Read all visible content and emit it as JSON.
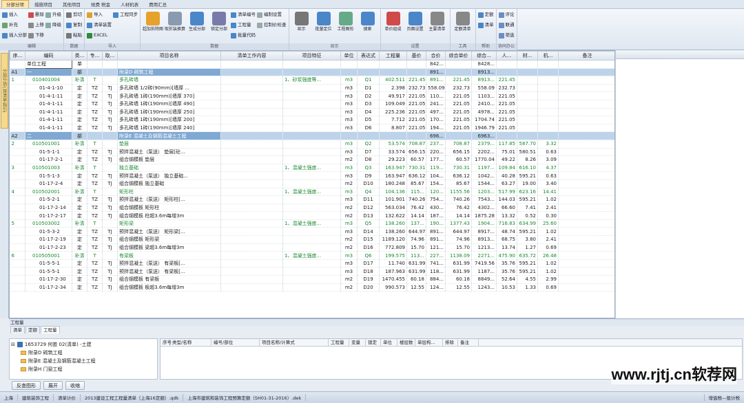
{
  "tabs": [
    "分部分项",
    "措施项目",
    "其他项目",
    "规费 税金",
    "人材机表",
    "费用汇总"
  ],
  "groups": [
    {
      "label": "编辑",
      "cols": [
        [
          {
            "t": "插入",
            "c": "#4a86c8"
          },
          {
            "t": "补充",
            "c": "#6ba36b"
          },
          {
            "t": "插入分部",
            "c": "#4a86c8"
          }
        ],
        [
          {
            "t": "删除",
            "c": "#d04a4a"
          },
          {
            "t": "上移",
            "c": "#8a8a8a"
          },
          {
            "t": "下移",
            "c": "#8a8a8a"
          }
        ],
        [
          {
            "t": "升级",
            "c": "#8aa"
          },
          {
            "t": "降级",
            "c": "#8aa"
          }
        ]
      ]
    },
    {
      "label": "数据",
      "cols": [
        [
          {
            "t": "剪切",
            "c": "#777"
          },
          {
            "t": "复制",
            "c": "#4a86c8"
          },
          {
            "t": "粘贴",
            "c": "#777"
          }
        ]
      ]
    },
    {
      "label": "导入",
      "cols": [
        [
          {
            "t": "导入",
            "c": "#e0a030"
          },
          {
            "t": "清单装置",
            "c": "#4a86c8"
          },
          {
            "t": "EXCEL",
            "c": "#2f8a3a"
          }
        ],
        [
          {
            "t": "工程同步",
            "c": "#4a86c8"
          }
        ]
      ]
    }
  ],
  "large_buttons": [
    {
      "t": "超加拆除图",
      "c": "#e6a22b"
    },
    {
      "t": "取折装换算",
      "c": "#8a9bb0"
    },
    {
      "t": "生成分部",
      "c": "#4a86c8"
    },
    {
      "t": "锁定分部",
      "c": "#7a7aaa"
    },
    {
      "t": "显示",
      "c": "#777"
    },
    {
      "t": "批量定位",
      "c": "#4a86c8"
    },
    {
      "t": "工程图形",
      "c": "#6a8"
    },
    {
      "t": "搜索",
      "c": "#4a86c8"
    },
    {
      "t": "单价组成",
      "c": "#d04a4a"
    },
    {
      "t": "页面设置",
      "c": "#4a86c8"
    },
    {
      "t": "主要清单",
      "c": "#888"
    },
    {
      "t": "定额清单",
      "c": "#888"
    }
  ],
  "data_group": {
    "label": "数据",
    "items": [
      "清单编号",
      "工程量",
      "批量代码",
      "编制设置",
      "控制价检查"
    ]
  },
  "misc_items": [
    "定额",
    "清单",
    "评论",
    "联通",
    "筛选"
  ],
  "group_labels": {
    "view": "显示",
    "settings": "设置",
    "tools": "工具",
    "help": "帮助",
    "collab": "协同办公"
  },
  "side_tab": "分部分项(按清单指引)",
  "columns": [
    "序...",
    "编码",
    "类...",
    "专...",
    "取...",
    "项目名称",
    "清单工作内容",
    "项目特征",
    "单位",
    "表达式",
    "工程量",
    "基价",
    "合价",
    "综合单价",
    "综合...",
    "人...",
    "材...",
    "机...",
    "备注"
  ],
  "rows": [
    {
      "k": "unit",
      "c": [
        "",
        "单位工程",
        "单",
        "",
        "",
        "",
        "",
        "",
        "",
        "",
        "",
        "",
        "842...",
        "",
        "8428...",
        "",
        "",
        "",
        ""
      ]
    },
    {
      "k": "sec",
      "c": [
        "A1",
        "一",
        "部",
        "",
        "",
        "附录D 砌筑工程",
        "",
        "",
        "",
        "",
        "",
        "",
        "891...",
        "",
        "8913...",
        "",
        "",
        "",
        ""
      ]
    },
    {
      "k": "item",
      "c": [
        "1",
        "010401004",
        "补清",
        "T",
        "",
        "多孔砖墙",
        "",
        "1、砂浆强度等...",
        "m3",
        "Q1",
        "402.511",
        "221.45",
        "891...",
        "221.45",
        "8913...",
        "221.45",
        "",
        "",
        ""
      ]
    },
    {
      "k": "sub",
      "c": [
        "",
        "01-4-1-10",
        "定",
        "TZ",
        "TJ",
        "多孔砖墙 1/2砖(90mm)[墙厚 ...",
        "",
        "",
        "m3",
        "D1",
        "2.398",
        "232.73",
        "558.09",
        "232.73",
        "558.09",
        "232.73",
        "",
        "",
        ""
      ]
    },
    {
      "k": "sub",
      "c": [
        "",
        "01-4-1-11",
        "定",
        "TZ",
        "TJ",
        "多孔砖墙 1砖(190mm)[墙厚 370]",
        "",
        "",
        "m3",
        "D2",
        "49.917",
        "221.05",
        "110...",
        "221.05",
        "1103...",
        "221.05",
        "",
        "",
        ""
      ]
    },
    {
      "k": "sub",
      "c": [
        "",
        "01-4-1-11",
        "定",
        "TZ",
        "TJ",
        "多孔砖墙 1砖(190mm)[墙厚 490]",
        "",
        "",
        "m3",
        "D3",
        "109.049",
        "221.05",
        "241...",
        "221.05",
        "2410...",
        "221.05",
        "",
        "",
        ""
      ]
    },
    {
      "k": "sub",
      "c": [
        "",
        "01-4-1-11",
        "定",
        "TZ",
        "TJ",
        "多孔砖墙 1砖(190mm)[墙厚 250]",
        "",
        "",
        "m3",
        "D4",
        "225.236",
        "221.05",
        "497...",
        "221.05",
        "4978...",
        "221.05",
        "",
        "",
        ""
      ]
    },
    {
      "k": "sub",
      "c": [
        "",
        "01-4-1-11",
        "定",
        "TZ",
        "TJ",
        "多孔砖墙 1砖(190mm)[墙厚 200]",
        "",
        "",
        "m3",
        "D5",
        "7.712",
        "221.05",
        "170...",
        "221.05",
        "1704.74",
        "221.05",
        "",
        "",
        ""
      ]
    },
    {
      "k": "sub",
      "c": [
        "",
        "01-4-1-11",
        "定",
        "TZ",
        "TJ",
        "多孔砖墙 1砖(190mm)[墙厚 240]",
        "",
        "",
        "m3",
        "D6",
        "8.807",
        "221.05",
        "194...",
        "221.05",
        "1946.79",
        "221.05",
        "",
        "",
        ""
      ]
    },
    {
      "k": "sec",
      "c": [
        "A2",
        "二",
        "部",
        "",
        "",
        "附录E 混凝土及钢筋混凝土工程",
        "",
        "",
        "",
        "",
        "",
        "",
        "696...",
        "",
        "6963...",
        "",
        "",
        "",
        ""
      ]
    },
    {
      "k": "item",
      "c": [
        "2",
        "010501001",
        "补清",
        "T",
        "",
        "垫层",
        "",
        "",
        "m3",
        "Q2",
        "53.574",
        "708.87",
        "237...",
        "708.87",
        "2379...",
        "117.85",
        "587.70",
        "3.32",
        ""
      ]
    },
    {
      "k": "sub",
      "c": [
        "",
        "01-5-1-1",
        "定",
        "TZ",
        "TJ",
        "预拌混凝土（泵送） 垫层[砼...",
        "",
        "",
        "m3",
        "D7",
        "33.574",
        "656.15",
        "220...",
        "656.15",
        "2202...",
        "75.01",
        "580.51",
        "0.63",
        ""
      ]
    },
    {
      "k": "sub",
      "c": [
        "",
        "01-17-2-1",
        "定",
        "TZ",
        "TJ",
        "组合钢模板 垫层",
        "",
        "",
        "m2",
        "D8",
        "29.223",
        "60.57",
        "177...",
        "60.57",
        "1770.04",
        "49.22",
        "8.26",
        "3.09",
        ""
      ]
    },
    {
      "k": "item",
      "c": [
        "3",
        "010501003",
        "补清",
        "T",
        "",
        "独立基础",
        "",
        "1、混凝土强度...",
        "m3",
        "Q3",
        "163.947",
        "730.31",
        "119...",
        "730.31",
        "1197...",
        "109.84",
        "616.10",
        "4.37",
        ""
      ]
    },
    {
      "k": "sub",
      "c": [
        "",
        "01-5-1-3",
        "定",
        "TZ",
        "TJ",
        "预拌混凝土（泵送） 独立基础...",
        "",
        "",
        "m3",
        "D9",
        "163.947",
        "636.12",
        "104...",
        "636.12",
        "1042...",
        "40.28",
        "595.21",
        "0.63",
        ""
      ]
    },
    {
      "k": "sub",
      "c": [
        "",
        "01-17-2-4",
        "定",
        "TZ",
        "TJ",
        "组合钢模板 独立基础",
        "",
        "",
        "m2",
        "D10",
        "180.248",
        "85.67",
        "154...",
        "85.67",
        "1544...",
        "63.27",
        "19.00",
        "3.40",
        ""
      ]
    },
    {
      "k": "item",
      "c": [
        "4",
        "010502001",
        "补清",
        "T",
        "",
        "矩形柱",
        "",
        "1、混凝土强度...",
        "m3",
        "Q4",
        "104.136",
        "115...",
        "120...",
        "1155.56",
        "1203...",
        "517.99",
        "623.16",
        "14.41",
        ""
      ]
    },
    {
      "k": "sub",
      "c": [
        "",
        "01-5-2-1",
        "定",
        "TZ",
        "TJ",
        "预拌混凝土（泵送） 矩形柱[...",
        "",
        "",
        "m3",
        "D11",
        "101.901",
        "740.26",
        "754...",
        "740.26",
        "7543...",
        "144.03",
        "595.21",
        "1.02",
        ""
      ]
    },
    {
      "k": "sub",
      "c": [
        "",
        "01-17-2-14",
        "定",
        "TZ",
        "TJ",
        "组合钢模板 矩形柱",
        "",
        "",
        "m2",
        "D12",
        "563.034",
        "76.42",
        "430...",
        "76.42",
        "4302...",
        "66.60",
        "7.41",
        "2.41",
        ""
      ]
    },
    {
      "k": "sub",
      "c": [
        "",
        "01-17-2-17",
        "定",
        "TZ",
        "TJ",
        "组合钢模板 柱超3.6m每增3m",
        "",
        "",
        "m2",
        "D13",
        "132.622",
        "14.14",
        "187...",
        "14.14",
        "1875.28",
        "13.32",
        "0.52",
        "0.30",
        ""
      ]
    },
    {
      "k": "item",
      "c": [
        "5",
        "010503002",
        "补清",
        "T",
        "",
        "矩形梁",
        "",
        "1、混凝土强度...",
        "m3",
        "Q5",
        "138.260",
        "137...",
        "190...",
        "1377.43",
        "1904...",
        "716.83",
        "634.99",
        "25.60",
        ""
      ]
    },
    {
      "k": "sub",
      "c": [
        "",
        "01-5-3-2",
        "定",
        "TZ",
        "TJ",
        "预拌混凝土（泵送） 矩形梁[...",
        "",
        "",
        "m3",
        "D14",
        "138.260",
        "644.97",
        "891...",
        "644.97",
        "8917...",
        "48.74",
        "595.21",
        "1.02",
        ""
      ]
    },
    {
      "k": "sub",
      "c": [
        "",
        "01-17-2-19",
        "定",
        "TZ",
        "TJ",
        "组合钢模板 矩形梁",
        "",
        "",
        "m2",
        "D15",
        "1189.120",
        "74.96",
        "891...",
        "74.96",
        "8913...",
        "68.75",
        "3.80",
        "2.41",
        ""
      ]
    },
    {
      "k": "sub",
      "c": [
        "",
        "01-17-2-23",
        "定",
        "TZ",
        "TJ",
        "组合钢模板 梁超3.6m每增3m",
        "",
        "",
        "m2",
        "D16",
        "772.809",
        "15.70",
        "121...",
        "15.70",
        "1213...",
        "13.74",
        "1.27",
        "0.69",
        ""
      ]
    },
    {
      "k": "item",
      "c": [
        "6",
        "010505001",
        "补清",
        "T",
        "",
        "有梁板",
        "",
        "1、混凝土强度...",
        "m3",
        "Q6",
        "199.575",
        "113...",
        "227...",
        "1138.09",
        "2271...",
        "475.90",
        "635.72",
        "26.48",
        ""
      ]
    },
    {
      "k": "sub",
      "c": [
        "",
        "01-5-5-1",
        "定",
        "TZ",
        "TJ",
        "预拌混凝土（泵送） 有梁板[...",
        "",
        "",
        "m3",
        "D17",
        "11.740",
        "631.99",
        "741...",
        "631.99",
        "7419.56",
        "35.76",
        "595.21",
        "1.02",
        ""
      ]
    },
    {
      "k": "sub",
      "c": [
        "",
        "01-5-5-1",
        "定",
        "TZ",
        "TJ",
        "预拌混凝土（泵送） 有梁板[...",
        "",
        "",
        "m3",
        "D18",
        "187.963",
        "631.99",
        "118...",
        "631.99",
        "1187...",
        "35.76",
        "595.21",
        "1.02",
        ""
      ]
    },
    {
      "k": "sub",
      "c": [
        "",
        "01-17-2-30",
        "定",
        "TZ",
        "TJ",
        "组合钢模板 有梁板",
        "",
        "",
        "m2",
        "D19",
        "1470.455",
        "60.18",
        "884...",
        "60.18",
        "8849...",
        "52.64",
        "4.55",
        "2.99",
        ""
      ]
    },
    {
      "k": "sub",
      "c": [
        "",
        "01-17-2-34",
        "定",
        "TZ",
        "TJ",
        "组合钢模板 板超3.6m每增3m",
        "",
        "",
        "m2",
        "D20",
        "990.573",
        "12.55",
        "124...",
        "12.55",
        "1243...",
        "10.53",
        "1.33",
        "0.69",
        ""
      ]
    }
  ],
  "quantity_panel": {
    "title": "工程量",
    "tabs": [
      "清单",
      "定额",
      "工程量"
    ],
    "tree_root": "1653729 何苗 02(清单) -土建",
    "tree_items": [
      "附录D 砌筑工程",
      "附录E 混凝土及钢筋混凝土工程",
      "附录H 门窗工程"
    ],
    "headers": [
      "序号",
      "类型/名称",
      "编号/部位",
      "项目名称/计算式",
      "工程量",
      "变量",
      "锁定",
      "单位",
      "楼层数",
      "单层构...",
      "排除",
      "备注"
    ],
    "buttons": [
      "反查图形",
      "展开",
      "收缩"
    ]
  },
  "status": [
    "上海",
    "建筑装饰工程",
    "清单计价",
    "2013建设工程工程量清单（上海16定额）.qdk",
    "上海市建筑和装饰工程预算定额（SH01-31-2016）.dek"
  ],
  "status_right": "增值税—般计税",
  "watermark": "www.rjtj.cn软荐网"
}
